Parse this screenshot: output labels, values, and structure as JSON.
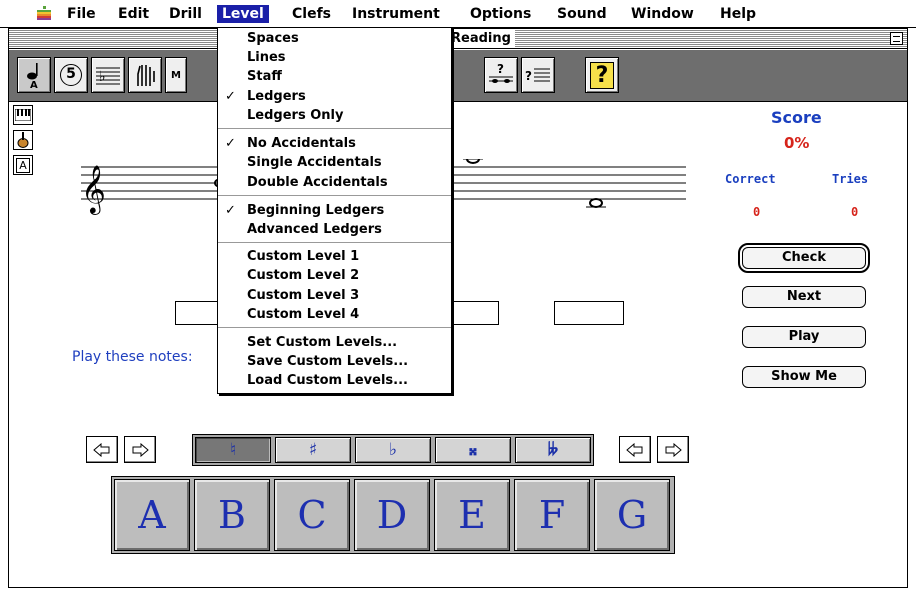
{
  "menubar": {
    "items": [
      "File",
      "Edit",
      "Drill",
      "Level",
      "Clefs",
      "Instrument",
      "Options",
      "Sound",
      "Window",
      "Help"
    ]
  },
  "window": {
    "title": "Reading"
  },
  "toolbar": {
    "tool_5_label": "5"
  },
  "level_menu": {
    "items": [
      {
        "label": "Spaces",
        "checked": false
      },
      {
        "label": "Lines",
        "checked": false
      },
      {
        "label": "Staff",
        "checked": false
      },
      {
        "label": "Ledgers",
        "checked": true
      },
      {
        "label": "Ledgers Only",
        "checked": false
      },
      {
        "label": "No Accidentals",
        "checked": true
      },
      {
        "label": "Single Accidentals",
        "checked": false
      },
      {
        "label": "Double Accidentals",
        "checked": false
      },
      {
        "label": "Beginning Ledgers",
        "checked": true
      },
      {
        "label": "Advanced Ledgers",
        "checked": false
      },
      {
        "label": "Custom Level  1",
        "checked": false
      },
      {
        "label": "Custom Level  2",
        "checked": false
      },
      {
        "label": "Custom Level  3",
        "checked": false
      },
      {
        "label": "Custom Level  4",
        "checked": false
      },
      {
        "label": "Set Custom Levels...",
        "checked": false
      },
      {
        "label": "Save Custom Levels...",
        "checked": false
      },
      {
        "label": "Load Custom Levels...",
        "checked": false
      }
    ],
    "check_mark": "✓"
  },
  "main": {
    "play_label": "Play these notes:"
  },
  "score": {
    "title": "Score",
    "value": "0%",
    "correct_label": "Correct",
    "tries_label": "Tries",
    "correct_value": "0",
    "tries_value": "0"
  },
  "actions": {
    "check": "Check",
    "next": "Next",
    "play": "Play",
    "show_me": "Show Me"
  },
  "accidentals": [
    {
      "symbol": "♮",
      "selected": true
    },
    {
      "symbol": "♯",
      "selected": false
    },
    {
      "symbol": "♭",
      "selected": false
    },
    {
      "symbol": "𝄪",
      "selected": false
    },
    {
      "symbol": "𝄫",
      "selected": false
    }
  ],
  "notes": [
    "A",
    "B",
    "C",
    "D",
    "E",
    "F",
    "G"
  ],
  "colors": {
    "menu_highlight": "#1a1fa8",
    "label_blue": "#1a3fbf",
    "score_red": "#d6241b"
  }
}
